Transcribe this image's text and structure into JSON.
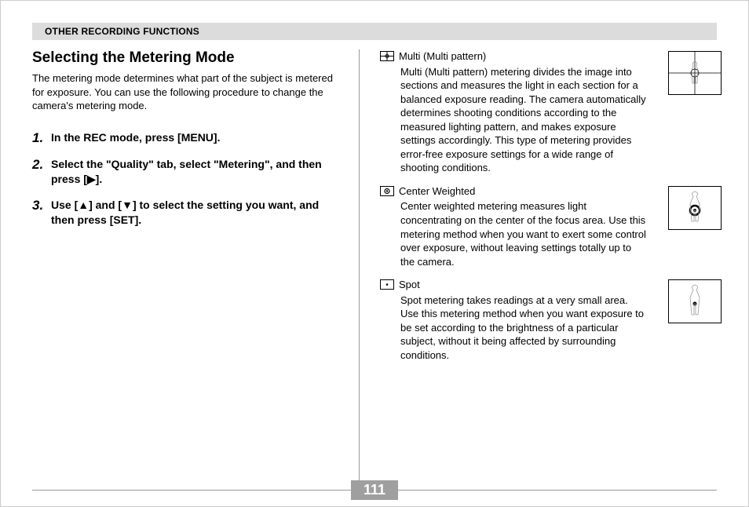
{
  "header": {
    "title": "OTHER RECORDING FUNCTIONS"
  },
  "left": {
    "section_title": "Selecting the Metering Mode",
    "intro": "The metering mode determines what part of the subject is metered for exposure. You can use the following procedure to change the camera's metering mode.",
    "steps": [
      {
        "num": "1.",
        "text": "In the REC mode, press [MENU]."
      },
      {
        "num": "2.",
        "text": "Select the \"Quality\" tab, select \"Metering\", and then press [▶]."
      },
      {
        "num": "3.",
        "text": "Use [▲] and [▼] to select the setting you want, and then press [SET]."
      }
    ]
  },
  "right": {
    "modes": [
      {
        "icon": "multi",
        "title": "Multi (Multi pattern)",
        "desc": "Multi (Multi pattern) metering divides the image into sections and measures the light in each section for a balanced exposure reading. The camera automatically determines shooting conditions according to the measured lighting pattern, and makes exposure settings accordingly. This type of metering provides error-free exposure settings for a wide range of shooting conditions."
      },
      {
        "icon": "center",
        "title": "Center Weighted",
        "desc": "Center weighted metering measures light concentrating on the center of the focus area. Use this metering method when you want to exert some control over exposure, without leaving settings totally up to the camera."
      },
      {
        "icon": "spot",
        "title": "Spot",
        "desc": "Spot metering takes readings at a very small area. Use this metering method when you want exposure to be set according to the brightness of a particular subject, without it being affected by surrounding conditions."
      }
    ]
  },
  "page_number": "111"
}
